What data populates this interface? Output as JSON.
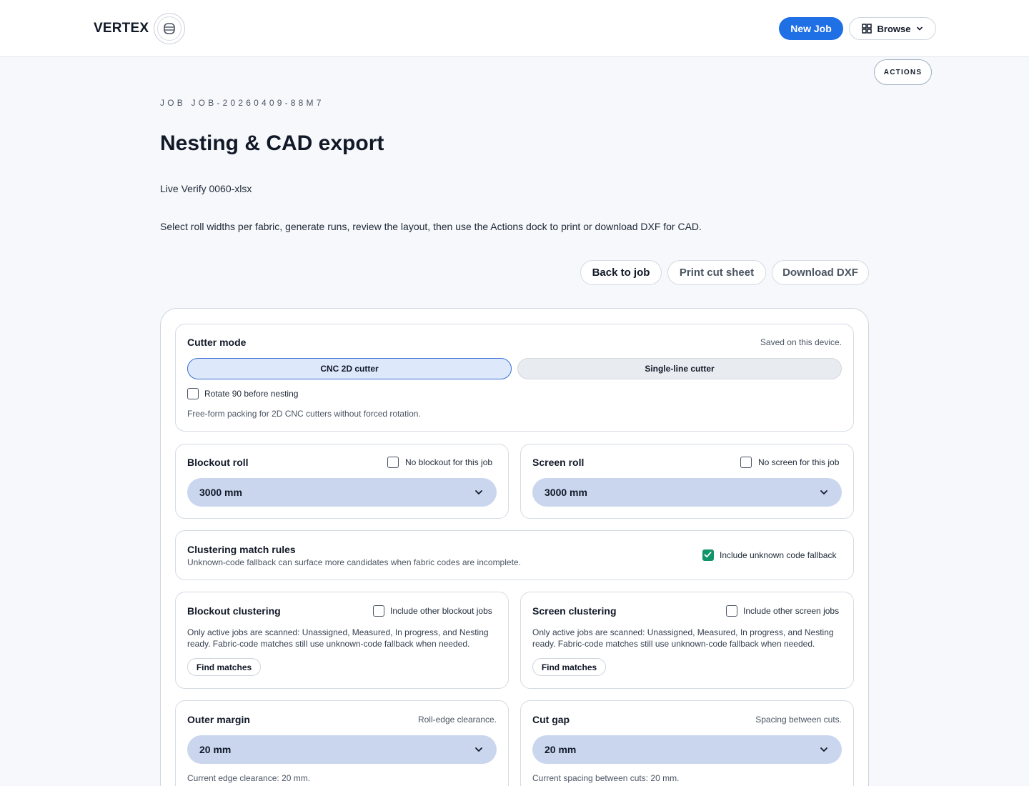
{
  "header": {
    "brand": "VERTEX",
    "new_job_label": "New Job",
    "browse_label": "Browse",
    "actions_label": "ACTIONS"
  },
  "page": {
    "job_id": "JOB JOB-20260409-88M7",
    "title": "Nesting & CAD export",
    "subtitle": "Live Verify 0060-xlsx",
    "description": "Select roll widths per fabric, generate runs, review the layout, then use the Actions dock to print or download DXF for CAD.",
    "buttons": {
      "back": "Back to job",
      "print": "Print cut sheet",
      "dxf": "Download DXF"
    }
  },
  "cutter_mode": {
    "title": "Cutter mode",
    "saved_note": "Saved on this device.",
    "options": [
      "CNC 2D cutter",
      "Single-line cutter"
    ],
    "selected": "CNC 2D cutter",
    "rotate_label": "Rotate 90 before nesting",
    "rotate_checked": false,
    "help": "Free-form packing for 2D CNC cutters without forced rotation."
  },
  "blockout_roll": {
    "title": "Blockout roll",
    "checkbox_label": "No blockout for this job",
    "checked": false,
    "value": "3000 mm"
  },
  "screen_roll": {
    "title": "Screen roll",
    "checkbox_label": "No screen for this job",
    "checked": false,
    "value": "3000 mm"
  },
  "clustering_rules": {
    "title": "Clustering match rules",
    "help": "Unknown-code fallback can surface more candidates when fabric codes are incomplete.",
    "checkbox_label": "Include unknown code fallback",
    "checked": true
  },
  "blockout_clustering": {
    "title": "Blockout clustering",
    "checkbox_label": "Include other blockout jobs",
    "checked": false,
    "help_line1": "Only active jobs are scanned: Unassigned, Measured, In progress, and Nesting",
    "help_line2": "ready. Fabric-code matches still use unknown-code fallback when needed.",
    "button": "Find matches"
  },
  "screen_clustering": {
    "title": "Screen clustering",
    "checkbox_label": "Include other screen jobs",
    "checked": false,
    "help_line1": "Only active jobs are scanned: Unassigned, Measured, In progress, and Nesting",
    "help_line2": "ready. Fabric-code matches still use unknown-code fallback when needed.",
    "button": "Find matches"
  },
  "outer_margin": {
    "title": "Outer margin",
    "note": "Roll-edge clearance.",
    "value": "20 mm",
    "current": "Current edge clearance: 20 mm."
  },
  "cut_gap": {
    "title": "Cut gap",
    "note": "Spacing between cuts.",
    "value": "20 mm",
    "current": "Current spacing between cuts: 20 mm."
  },
  "colors": {
    "primary": "#1f6fe5",
    "check_green": "#12946b",
    "select_bg": "#c9d6ee",
    "active_segment": "#dde8fb"
  }
}
